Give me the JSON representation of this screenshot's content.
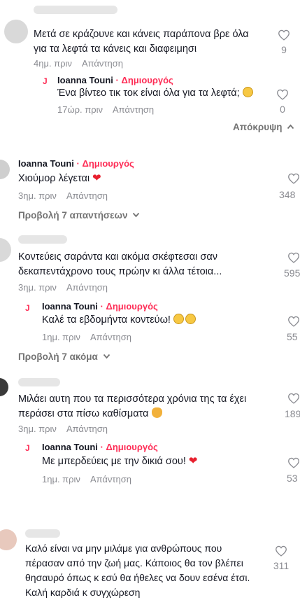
{
  "comments": [
    {
      "text": "Μετά σε κράζουνε και κάνεις παράπονα βρε όλα για τα λεφτά τα κάνεις και διαφειμησι",
      "time": "4ημ. πριν",
      "reply": "Απάντηση",
      "likes": "9"
    },
    {
      "author": "Ioanna Touni",
      "badge": "· Δημιουργός",
      "text": "Ένα βίντεο τικ τοκ είναι όλα για τα λεφτά;",
      "time": "17ώρ. πριν",
      "reply": "Απάντηση",
      "likes": "0"
    },
    {
      "author": "Ioanna Touni",
      "badge": "· Δημιουργός",
      "text": "Χιούμορ λέγεται",
      "time": "3ημ. πριν",
      "reply": "Απάντηση",
      "likes": "348"
    },
    {
      "text": "Κοντεύεις σαράντα και ακόμα σκέφτεσαι σαν δεκαπεντάχρονο τους πρώην κι άλλα τέτοια...",
      "time": "3ημ. πριν",
      "reply": "Απάντηση",
      "likes": "595"
    },
    {
      "author": "Ioanna Touni",
      "badge": "· Δημιουργός",
      "text": "Καλέ τα εβδομήντα κοντεύω!",
      "time": "1ημ. πριν",
      "reply": "Απάντηση",
      "likes": "55"
    },
    {
      "text": "Μιλάει αυτη που τα περισσότερα χρόνια της τα έχει περάσει στα πίσω καθίσματα",
      "time": "3ημ. πριν",
      "reply": "Απάντηση",
      "likes": "189"
    },
    {
      "author": "Ioanna Touni",
      "badge": "· Δημιουργός",
      "text": "Με μπερδεύεις με την δικιά σου!",
      "time": "1ημ. πριν",
      "reply": "Απάντηση",
      "likes": "53"
    },
    {
      "text": "Καλό είναι να μην μιλάμε για ανθρώπους που πέρασαν από την ζωή μας. Κάποιος θα τον βλέπει θησαυρό όπως κ εσύ θα ήθελες να δουν εσένα έτσι. Καλή καρδιά κ συγχώρεση",
      "likes": "311"
    }
  ],
  "hide_replies": "Απόκρυψη",
  "view_replies_7": "Προβολή 7 απαντήσεων",
  "view_more_7": "Προβολή 7 ακόμα",
  "creator_mark": "J",
  "icons": {
    "like": "heart-outline-icon",
    "expand": "chevron-down-icon",
    "collapse": "chevron-up-icon"
  },
  "colors": {
    "creator_badge": "#fe2c55",
    "secondary_text": "#8a8b91"
  }
}
